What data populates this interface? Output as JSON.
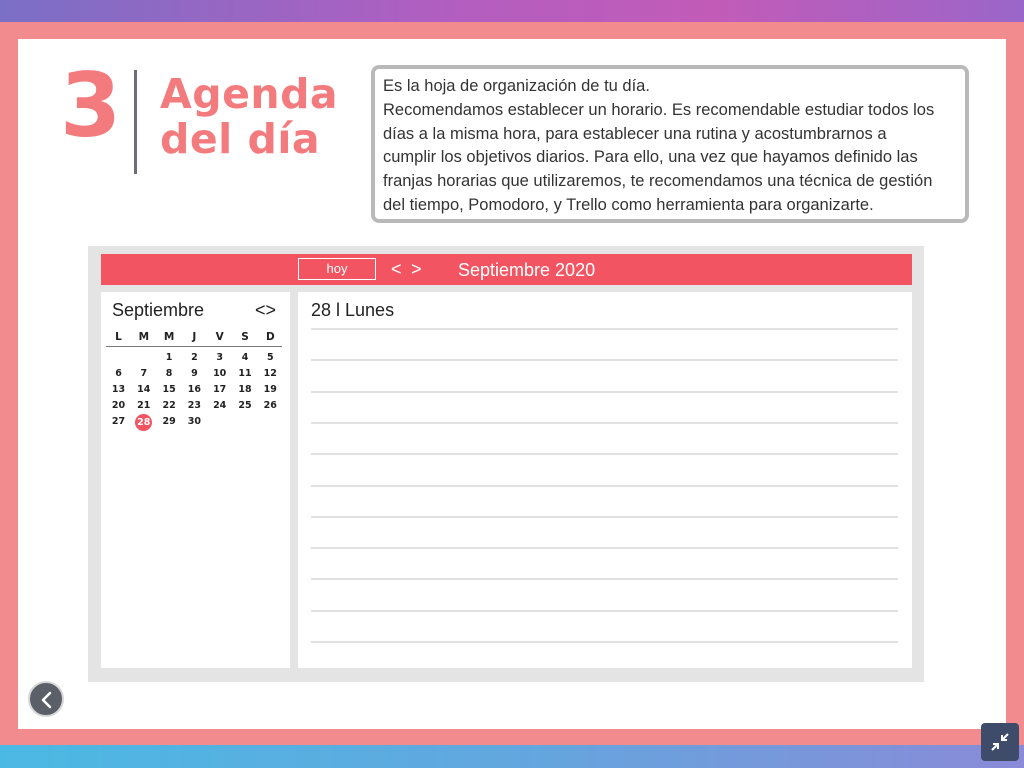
{
  "slide": {
    "number": "3",
    "title_line1": "Agenda",
    "title_line2": "del día",
    "description_lines": [
      "Es la hoja de organización de tu día.",
      "Recomendamos establecer un horario. Es recomendable estudiar todos los",
      "días a la misma hora, para establecer una rutina y acostumbrarnos a",
      "cumplir los objetivos diarios. Para ello, una vez que hayamos definido las",
      "franjas horarias que utilizaremos, te recomendamos una técnica de gestión",
      "del tiempo, Pomodoro, y Trello como herramienta para organizarte."
    ]
  },
  "calendar": {
    "today_label": "hoy",
    "prev_label": "<",
    "next_label": ">",
    "header_month": "Septiembre 2020",
    "mini_month": "Septiembre",
    "mini_nav": "<>",
    "weekdays": [
      "L",
      "M",
      "M",
      "J",
      "V",
      "S",
      "D"
    ],
    "weeks": [
      [
        "",
        "",
        "1",
        "2",
        "3",
        "4",
        "5"
      ],
      [
        "6",
        "7",
        "8",
        "9",
        "10",
        "11",
        "12"
      ],
      [
        "13",
        "14",
        "15",
        "16",
        "17",
        "18",
        "19"
      ],
      [
        "20",
        "21",
        "22",
        "23",
        "24",
        "25",
        "26"
      ],
      [
        "27",
        "28",
        "29",
        "30",
        "",
        "",
        ""
      ]
    ],
    "selected_day": "28",
    "day_title": "28 l Lunes",
    "accent_color": "#f25561"
  },
  "controls": {
    "back_icon": "chevron-left-icon",
    "collapse_icon": "collapse-arrows-icon"
  }
}
